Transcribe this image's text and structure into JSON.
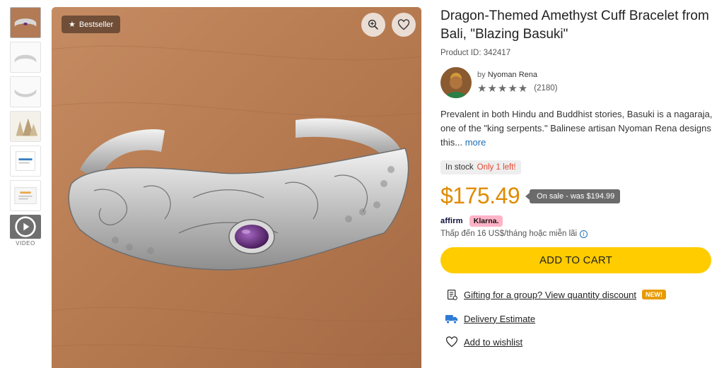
{
  "gallery": {
    "badge_label": "Bestseller",
    "video_label": "VIDEO"
  },
  "product": {
    "title": "Dragon-Themed Amethyst Cuff Bracelet from Bali, \"Blazing Basuki\"",
    "product_id": "Product ID: 342417",
    "artisan_by": "by",
    "artisan_name": "Nyoman Rena",
    "rating_stars": "★★★★★",
    "review_count": "(2180)",
    "description": "Prevalent in both Hindu and Buddhist stories, Basuki is a nagaraja, one of the \"king serpents.\" Balinese artisan Nyoman Rena designs this...",
    "more_link": "more",
    "stock_label": "In stock",
    "stock_remaining": "Only 1 left!",
    "price": "$175.49",
    "sale_note": "On sale - was $194.99",
    "affirm_label": "affirm",
    "klarna_label": "Klarna.",
    "installment_text": "Thấp đến 16 US$/tháng hoặc miễn lãi",
    "add_to_cart": "ADD TO CART"
  },
  "links": {
    "gifting": "Gifting for a group? View quantity discount",
    "new_badge": "NEW!",
    "delivery": "Delivery Estimate",
    "wishlist": "Add to wishlist"
  },
  "colors": {
    "price": "#e08a00",
    "cart_button": "#ffcc00",
    "klarna": "#ffb3c7",
    "new_badge": "#e89a00",
    "stock_alert": "#e4472f",
    "delivery_icon": "#2e7bd6"
  }
}
